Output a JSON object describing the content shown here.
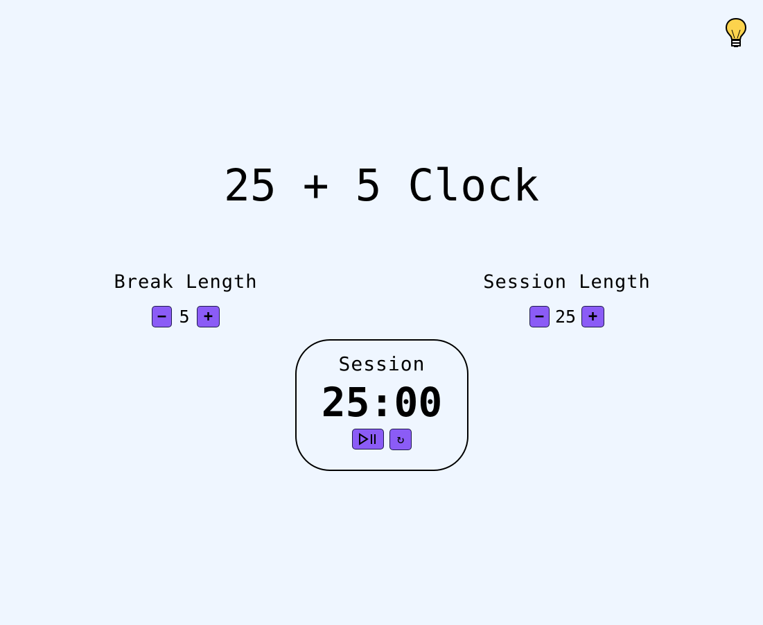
{
  "theme_toggle": {
    "icon": "lightbulb-icon",
    "color": "#fcd34d"
  },
  "title": "25 + 5 Clock",
  "break": {
    "label": "Break Length",
    "decrement_label": "−",
    "value": "5",
    "increment_label": "+"
  },
  "session": {
    "label": "Session Length",
    "decrement_label": "−",
    "value": "25",
    "increment_label": "+"
  },
  "timer": {
    "label": "Session",
    "time_left": "25:00",
    "start_stop_icon": "play-pause-icon",
    "reset_label": "↻"
  },
  "colors": {
    "background": "#eff6ff",
    "button": "#8b5cf6",
    "button_border": "#1e1b4b"
  }
}
